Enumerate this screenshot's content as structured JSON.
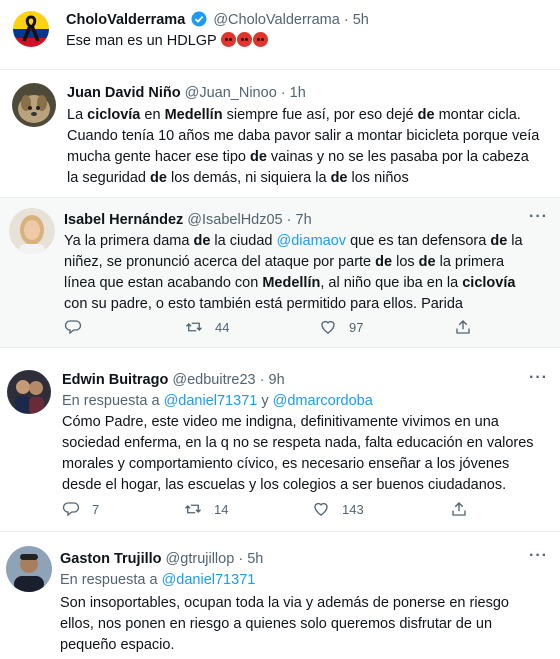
{
  "tweets": [
    {
      "name": "CholoValderrama",
      "handle": "@CholoValderrama",
      "time": "5h",
      "verified": true,
      "text_plain": "Ese man es un HDLGP",
      "emoji": [
        "pouting-face",
        "pouting-face",
        "pouting-face"
      ]
    },
    {
      "name": "Juan David Niño",
      "handle": "@Juan_Ninoo",
      "time": "1h",
      "segments": [
        {
          "t": "La ",
          "b": false
        },
        {
          "t": "ciclovía",
          "b": true
        },
        {
          "t": " en ",
          "b": false
        },
        {
          "t": "Medellín",
          "b": true
        },
        {
          "t": " siempre fue así, por eso dejé ",
          "b": false
        },
        {
          "t": "de",
          "b": true
        },
        {
          "t": " montar cicla. Cuando tenía 10 años me daba pavor salir a montar bicicleta porque veía mucha gente hacer ese tipo ",
          "b": false
        },
        {
          "t": "de",
          "b": true
        },
        {
          "t": " vainas y no se les pasaba por la cabeza la seguridad ",
          "b": false
        },
        {
          "t": "de",
          "b": true
        },
        {
          "t": " los demás, ni siquiera la ",
          "b": false
        },
        {
          "t": "de",
          "b": true
        },
        {
          "t": " los niños",
          "b": false
        }
      ]
    },
    {
      "name": "Isabel Hernández",
      "handle": "@IsabelHdz05",
      "time": "7h",
      "segments": [
        {
          "t": "Ya la primera dama ",
          "b": false
        },
        {
          "t": "de",
          "b": true
        },
        {
          "t": " la ciudad ",
          "b": false
        },
        {
          "t": "@diamaov",
          "m": true
        },
        {
          "t": " que es tan defensora ",
          "b": false
        },
        {
          "t": "de",
          "b": true
        },
        {
          "t": " la niñez, se pronunció acerca del ataque por parte ",
          "b": false
        },
        {
          "t": "de",
          "b": true
        },
        {
          "t": " los ",
          "b": false
        },
        {
          "t": "de",
          "b": true
        },
        {
          "t": " la primera línea que estan acabando con ",
          "b": false
        },
        {
          "t": "Medellín",
          "b": true
        },
        {
          "t": ", al niño que iba en la ",
          "b": false
        },
        {
          "t": "ciclovía",
          "b": true
        },
        {
          "t": " con su padre, o esto también está permitido para ellos. Parida",
          "b": false
        }
      ],
      "replies": "",
      "retweets": "44",
      "likes": "97"
    },
    {
      "name": "Edwin Buitrago",
      "handle": "@edbuitre23",
      "time": "9h",
      "reply_prefix": "En respuesta a",
      "reply_to_1": "@daniel71371",
      "reply_join": "y",
      "reply_to_2": "@dmarcordoba",
      "text": "Cómo Padre, este video me indigna, definitivamente vivimos en una sociedad enferma, en la q no se respeta nada, falta educación en valores morales y comportamiento cívico, es necesario enseñar a los jóvenes desde el hogar, las escuelas y los colegios a ser buenos ciudadanos.",
      "replies": "7",
      "retweets": "14",
      "likes": "143"
    },
    {
      "name": "Gaston Trujillo",
      "handle": "@gtrujillop",
      "time": "5h",
      "reply_prefix": "En respuesta a",
      "reply_to_1": "@daniel71371",
      "text": "Son insoportables, ocupan toda la via y además de ponerse en riesgo ellos, nos ponen en riesgo a quienes solo queremos disfrutar de un pequeño espacio."
    }
  ],
  "dot": "·",
  "colors": {
    "accent": "#1d9bf0",
    "muted": "#536471",
    "text": "#0f1419",
    "shaded_bg": "#f7f9f9"
  }
}
